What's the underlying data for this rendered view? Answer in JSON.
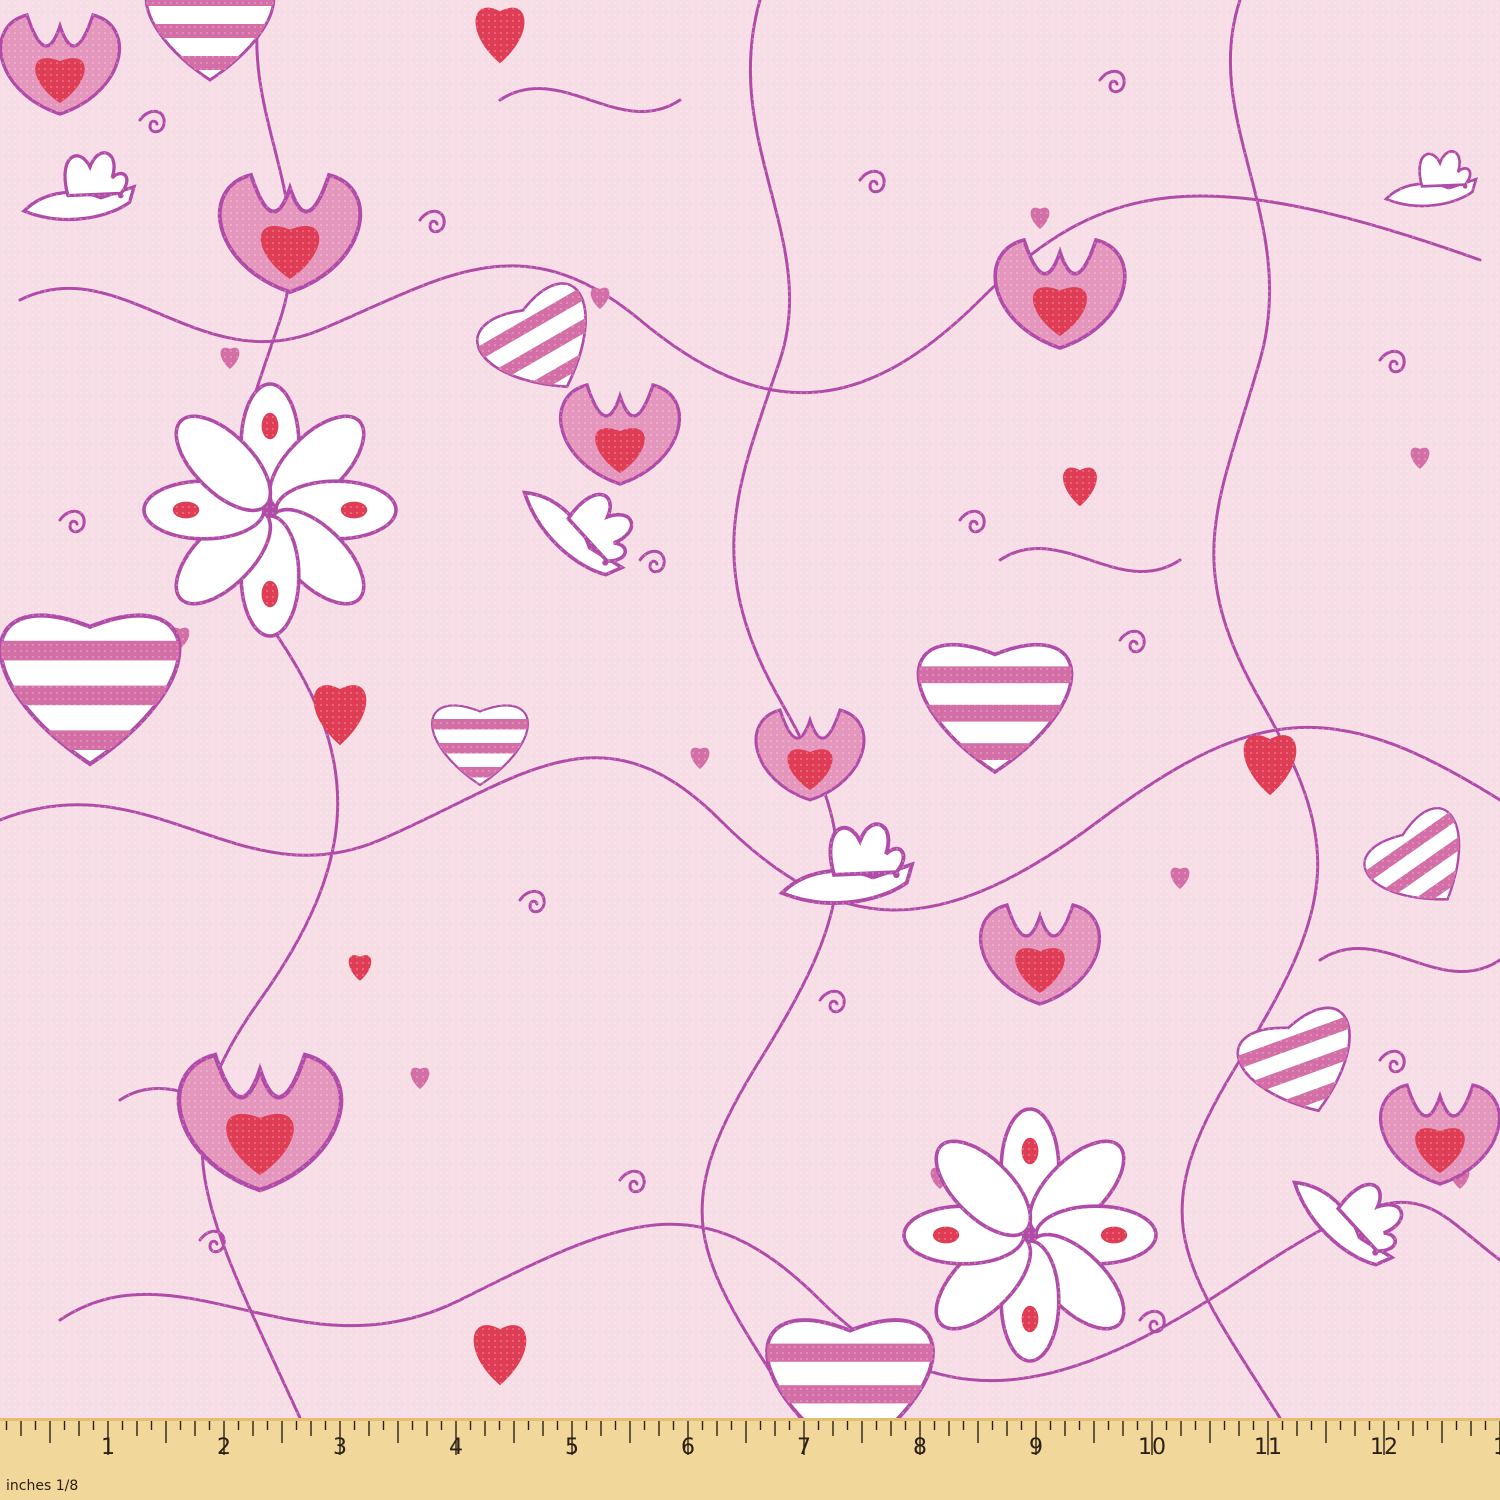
{
  "fabric": {
    "motif": "pink floral doodle pattern with hearts, birds and swirling vines",
    "colors": {
      "background": "#f7dde6",
      "line": "#b14ba8",
      "pink": "#e596bd",
      "rose": "#d36fa6",
      "red": "#df3d55",
      "white": "#ffffff"
    }
  },
  "ruler": {
    "unit_label": "inches 1/8",
    "numbers": [
      "1",
      "2",
      "3",
      "4",
      "5",
      "6",
      "7",
      "8",
      "9",
      "10",
      "11",
      "12",
      "1"
    ],
    "colors": {
      "wood": "#f2d79a",
      "wood_edge": "#e4bf72",
      "ink": "#2a2014"
    }
  }
}
